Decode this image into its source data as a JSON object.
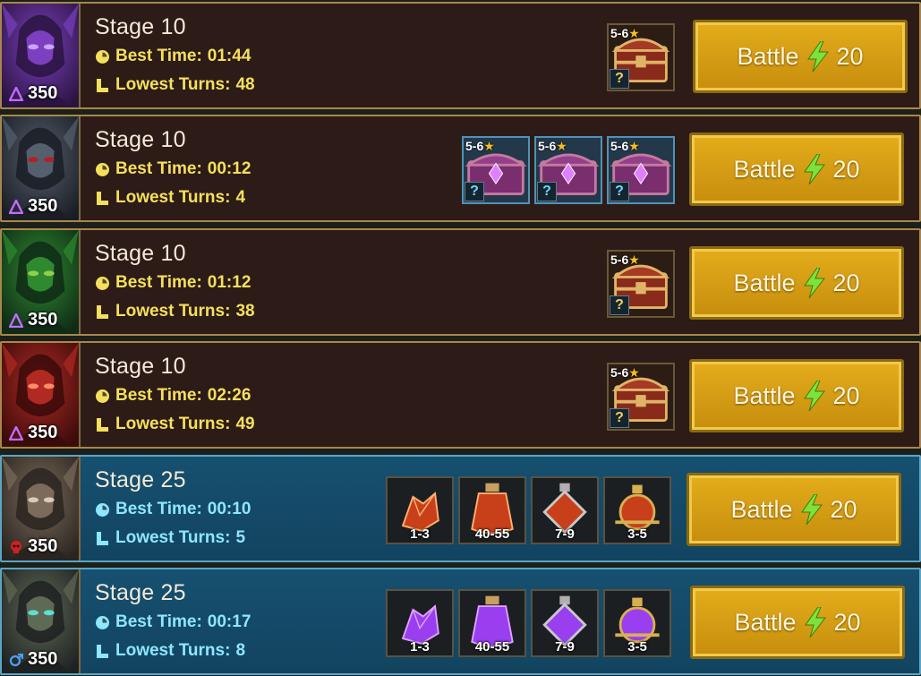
{
  "labels": {
    "best_time": "Best Time:",
    "lowest_turns": "Lowest Turns:",
    "battle": "Battle",
    "reward_rank": "5-6",
    "unknown": "?"
  },
  "colors": {
    "boss_row": "#2d1b18",
    "cursed_row": "#165070",
    "boss_stat_text": "#f4e05c",
    "cursed_stat_text": "#8ee6ff",
    "battle_button": "#e3ad1b",
    "energy_bolt": "#7ee23a"
  },
  "stages": [
    {
      "name": "Stage 10",
      "best_time": "01:44",
      "lowest_turns": "48",
      "boss_level": "350",
      "affinity_icon": "magic-affinity-icon",
      "theme": "boss",
      "portrait": "violet-knight-portrait",
      "energy_cost": "20",
      "rewards": [
        {
          "kind": "chest",
          "icon": "treasure-chest-icon"
        }
      ]
    },
    {
      "name": "Stage 10",
      "best_time": "00:12",
      "lowest_turns": "4",
      "boss_level": "350",
      "affinity_icon": "magic-affinity-icon",
      "theme": "boss",
      "portrait": "spider-queen-portrait",
      "energy_cost": "20",
      "rewards": [
        {
          "kind": "crate",
          "icon": "violet-crate-icon"
        },
        {
          "kind": "crate",
          "icon": "violet-crate-icon"
        },
        {
          "kind": "crate",
          "icon": "violet-crate-icon"
        }
      ]
    },
    {
      "name": "Stage 10",
      "best_time": "01:12",
      "lowest_turns": "38",
      "boss_level": "350",
      "affinity_icon": "magic-affinity-icon",
      "theme": "boss",
      "portrait": "dragon-portrait",
      "energy_cost": "20",
      "rewards": [
        {
          "kind": "chest",
          "icon": "treasure-chest-icon"
        }
      ]
    },
    {
      "name": "Stage 10",
      "best_time": "02:26",
      "lowest_turns": "49",
      "boss_level": "350",
      "affinity_icon": "magic-affinity-icon",
      "theme": "boss",
      "portrait": "fire-knight-portrait",
      "energy_cost": "20",
      "rewards": [
        {
          "kind": "chest",
          "icon": "treasure-chest-icon"
        }
      ]
    },
    {
      "name": "Stage 25",
      "best_time": "00:10",
      "lowest_turns": "5",
      "boss_level": "350",
      "affinity_icon": "force-affinity-icon",
      "theme": "cursed",
      "portrait": "horned-ogre-portrait",
      "energy_cost": "20",
      "rewards": [
        {
          "kind": "pot",
          "icon": "force-shard-icon",
          "qty": "1-3"
        },
        {
          "kind": "pot",
          "icon": "force-potion-large-icon",
          "qty": "40-55"
        },
        {
          "kind": "pot",
          "icon": "force-potion-medium-icon",
          "qty": "7-9"
        },
        {
          "kind": "pot",
          "icon": "force-potion-small-icon",
          "qty": "3-5"
        }
      ]
    },
    {
      "name": "Stage 25",
      "best_time": "00:17",
      "lowest_turns": "8",
      "boss_level": "350",
      "affinity_icon": "void-affinity-icon",
      "theme": "cursed",
      "portrait": "skull-warlord-portrait",
      "energy_cost": "20",
      "rewards": [
        {
          "kind": "pot",
          "icon": "void-shard-icon",
          "qty": "1-3"
        },
        {
          "kind": "pot",
          "icon": "void-potion-large-icon",
          "qty": "40-55"
        },
        {
          "kind": "pot",
          "icon": "void-potion-medium-icon",
          "qty": "7-9"
        },
        {
          "kind": "pot",
          "icon": "void-potion-small-icon",
          "qty": "3-5"
        }
      ]
    }
  ]
}
